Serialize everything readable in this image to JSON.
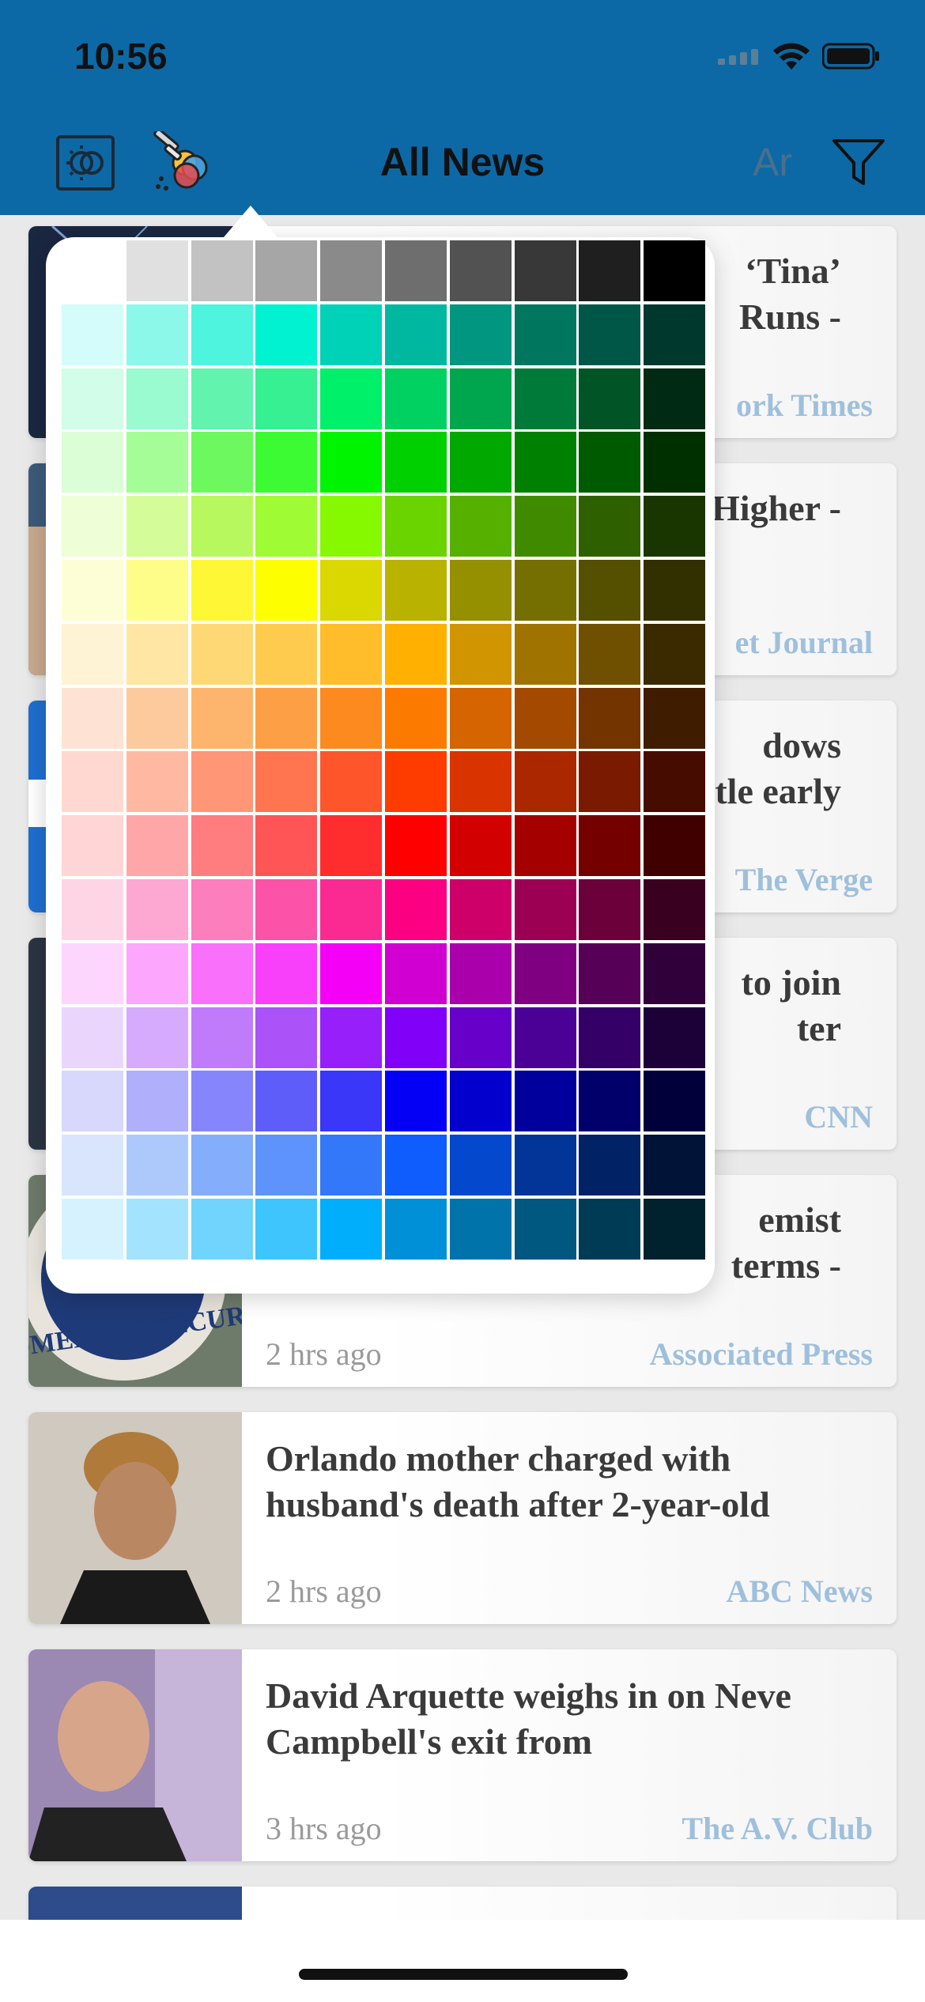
{
  "status_bar": {
    "time": "10:56"
  },
  "header": {
    "title": "All News",
    "font_button_label": "Ar",
    "icons": {
      "left_1": "brightness-icon",
      "left_2": "color-palette-icon",
      "right": "filter-icon"
    }
  },
  "cards": [
    {
      "headline_partial_1": "‘Tina’",
      "headline_partial_2": "Runs -",
      "time": "",
      "source": "ork Times"
    },
    {
      "headline_partial_1": "Higher -",
      "headline_partial_2": "",
      "time": "",
      "source": "et Journal"
    },
    {
      "headline_partial_1": "dows",
      "headline_partial_2": "tle early",
      "time": "",
      "source": "The Verge"
    },
    {
      "headline_partial_1": "to join",
      "headline_partial_2": "ter",
      "time": "",
      "source": "CNN"
    },
    {
      "headline_partial_1": "emist",
      "headline_partial_2": "terms -",
      "time": "2 hrs ago",
      "source": "Associated Press",
      "thumb_text": "HOMELAND SECURI"
    },
    {
      "headline": "Orlando mother charged with husband's death after 2-year-old",
      "time": "2 hrs ago",
      "source": "ABC News"
    },
    {
      "headline": "David Arquette weighs in on Neve Campbell's exit from",
      "time": "3 hrs ago",
      "source": "The A.V. Club"
    }
  ],
  "color_palette": {
    "rows": [
      [
        "#ffffff",
        "#e0e0e0",
        "#c2c2c2",
        "#a6a6a6",
        "#8a8a8a",
        "#6e6e6e",
        "#525252",
        "#383838",
        "#1f1f1f",
        "#000000"
      ],
      [
        "#d3fcfa",
        "#8cf8ea",
        "#4ef4de",
        "#00f2d0",
        "#00d2b8",
        "#00b8a0",
        "#00967f",
        "#00765f",
        "#005747",
        "#00382e"
      ],
      [
        "#d2fde8",
        "#9afad0",
        "#62f4ae",
        "#36f092",
        "#00f069",
        "#00d161",
        "#00a64d",
        "#007a38",
        "#005425",
        "#002a13"
      ],
      [
        "#dbfed6",
        "#a4fd96",
        "#6ef85f",
        "#3dfb33",
        "#00f400",
        "#00d000",
        "#00a800",
        "#008000",
        "#005a00",
        "#003000"
      ],
      [
        "#eefed6",
        "#d4fd9a",
        "#b7f85f",
        "#9ffb34",
        "#86f900",
        "#6ad400",
        "#56b000",
        "#408a00",
        "#2e6000",
        "#1a3600"
      ],
      [
        "#fefed6",
        "#fefd8a",
        "#fdf735",
        "#fdfe00",
        "#dbd700",
        "#b9b300",
        "#959000",
        "#746f00",
        "#554f00",
        "#322f00"
      ],
      [
        "#fff3d6",
        "#ffe6a4",
        "#ffd876",
        "#ffcb4e",
        "#ffbd2b",
        "#ffb000",
        "#d09500",
        "#a07300",
        "#6f5000",
        "#3b2a00"
      ],
      [
        "#fee3d4",
        "#fdca9e",
        "#fdb56e",
        "#fd9f45",
        "#fd8a1f",
        "#fc7a00",
        "#d46500",
        "#a34a00",
        "#733400",
        "#3f1b00"
      ],
      [
        "#ffd9d1",
        "#ffb9a3",
        "#ff9676",
        "#ff7550",
        "#ff552b",
        "#ff3c00",
        "#d93300",
        "#aa2700",
        "#7a1a00",
        "#460c00"
      ],
      [
        "#ffd5d6",
        "#ffa7a8",
        "#ff7d7e",
        "#ff5556",
        "#ff2d2d",
        "#ff0000",
        "#d30000",
        "#a40000",
        "#740000",
        "#400000"
      ],
      [
        "#fed5e5",
        "#fda8d2",
        "#fc7ebc",
        "#fc52a8",
        "#fb2a93",
        "#fb0080",
        "#cd006a",
        "#9c0052",
        "#6b003a",
        "#3a0020"
      ],
      [
        "#fdd6fe",
        "#fca6fd",
        "#f970fb",
        "#f83ffa",
        "#f500f7",
        "#d000d2",
        "#a900ab",
        "#800082",
        "#560058",
        "#30003a"
      ],
      [
        "#ead6fd",
        "#d6aafc",
        "#c07bfa",
        "#ab52f9",
        "#961ffa",
        "#8000f8",
        "#6700c9",
        "#4b0096",
        "#340068",
        "#1c0038"
      ],
      [
        "#d8d8fd",
        "#b0affc",
        "#8685fb",
        "#5f5dfa",
        "#3a37f8",
        "#0400f6",
        "#0300ce",
        "#02009c",
        "#01006b",
        "#01003a"
      ],
      [
        "#d8e5fd",
        "#adc9fc",
        "#84adfb",
        "#5d93fa",
        "#3378f9",
        "#0e5dfc",
        "#0448cd",
        "#033498",
        "#022266",
        "#011336"
      ],
      [
        "#d6f2fe",
        "#a3e3fd",
        "#71d4fc",
        "#3ec5fd",
        "#00aefc",
        "#0090d8",
        "#0073ab",
        "#00577f",
        "#003b56",
        "#00212e"
      ]
    ]
  }
}
